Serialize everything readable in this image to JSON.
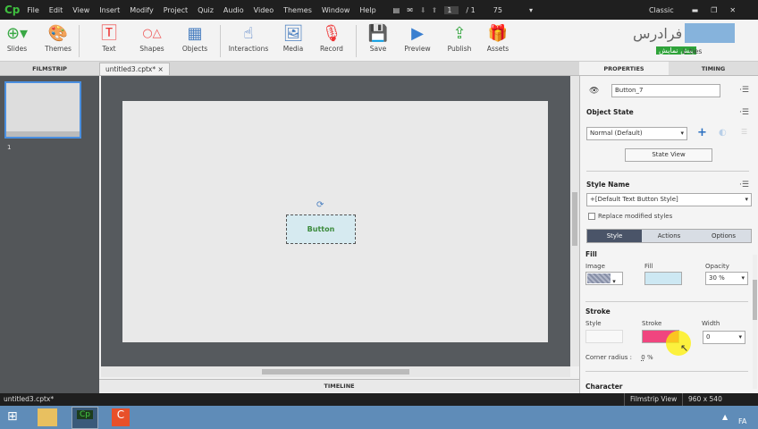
{
  "app": {
    "logo": "Cp",
    "workspace": "Classic"
  },
  "menu": [
    "File",
    "Edit",
    "View",
    "Insert",
    "Modify",
    "Project",
    "Quiz",
    "Audio",
    "Video",
    "Themes",
    "Window",
    "Help"
  ],
  "pager": {
    "current": "1",
    "total": "/ 1",
    "zoom": "75"
  },
  "toolbar": [
    {
      "label": "Slides",
      "icon": "plus-circle-icon"
    },
    {
      "label": "Themes",
      "icon": "palette-icon"
    },
    {
      "label": "Text",
      "icon": "text-icon"
    },
    {
      "label": "Shapes",
      "icon": "shapes-icon"
    },
    {
      "label": "Objects",
      "icon": "objects-icon"
    },
    {
      "label": "Interactions",
      "icon": "hand-pointer-icon"
    },
    {
      "label": "Media",
      "icon": "image-icon"
    },
    {
      "label": "Record",
      "icon": "microphone-icon"
    },
    {
      "label": "Save",
      "icon": "save-icon"
    },
    {
      "label": "Preview",
      "icon": "play-icon"
    },
    {
      "label": "Publish",
      "icon": "publish-icon"
    },
    {
      "label": "Assets",
      "icon": "assets-icon"
    }
  ],
  "watermark": {
    "text": "فرادرس",
    "badge": "پیش نمایش",
    "behind": "L       ties"
  },
  "tabs": {
    "filmstrip": "FILMSTRIP",
    "document": "untitled3.cptx*",
    "properties": "PROPERTIES",
    "timing": "TIMING",
    "timeline": "TIMELINE"
  },
  "filmstrip": {
    "slide_number": "1"
  },
  "canvas": {
    "button_label": "Button"
  },
  "properties": {
    "name": "Button_7",
    "object_state": "Object State",
    "state_value": "Normal (Default)",
    "state_view": "State View",
    "style_name": "Style Name",
    "style_value": "+[Default Text Button Style]",
    "replace": "Replace modified styles",
    "subtabs": [
      "Style",
      "Actions",
      "Options"
    ],
    "fill": {
      "title": "Fill",
      "image": "Image",
      "fill": "Fill",
      "opacity": "Opacity",
      "opacity_value": "30 %"
    },
    "stroke": {
      "title": "Stroke",
      "style": "Style",
      "stroke": "Stroke",
      "width": "Width",
      "width_value": "0",
      "color": "#f0457f"
    },
    "corner": {
      "label": "Corner radius :",
      "value": "0",
      "unit": "%"
    },
    "character": "Character"
  },
  "status": {
    "file": "untitled3.cptx*",
    "view": "Filmstrip View",
    "size": "960 x 540"
  },
  "taskbar": {
    "lang": "FA"
  }
}
